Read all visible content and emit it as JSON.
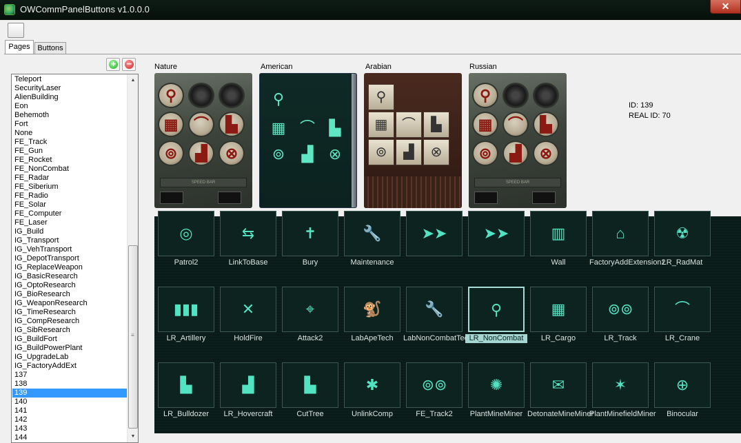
{
  "window": {
    "title": "OWCommPanelButtons v1.0.0.0",
    "close_label": "✕"
  },
  "tabs": [
    "Pages",
    "Buttons"
  ],
  "list_controls": {
    "add": "+",
    "remove": "−"
  },
  "pages_list": [
    "Teleport",
    "SecurityLaser",
    "AlienBuilding",
    "Eon",
    "Behemoth",
    "Fort",
    "None",
    "FE_Track",
    "FE_Gun",
    "FE_Rocket",
    "FE_NonCombat",
    "FE_Radar",
    "FE_Siberium",
    "FE_Radio",
    "FE_Solar",
    "FE_Computer",
    "FE_Laser",
    "IG_Build",
    "IG_Transport",
    "IG_VehTransport",
    "IG_DepotTransport",
    "IG_ReplaceWeapon",
    "IG_BasicResearch",
    "IG_OptoResearch",
    "IG_BioResearch",
    "IG_WeaponResearch",
    "IG_TimeResearch",
    "IG_CompResearch",
    "IG_SibResearch",
    "IG_BuildFort",
    "IG_BuildPowerPlant",
    "IG_UpgradeLab",
    "IG_FactoryAddExt",
    "137",
    "138",
    "139",
    "140",
    "141",
    "142",
    "143",
    "144"
  ],
  "selected_page": "139",
  "preview_labels": [
    "Nature",
    "American",
    "Arabian",
    "Russian"
  ],
  "speed_bar_text": "SPEED BAR",
  "id_info": {
    "id": "ID: 139",
    "real_id": "REAL ID: 70"
  },
  "buttons": [
    {
      "label": "Patrol2",
      "icon": "patrol-icon",
      "glyph": "◎"
    },
    {
      "label": "LinkToBase",
      "icon": "link-icon",
      "glyph": "⇆"
    },
    {
      "label": "Bury",
      "icon": "bury-icon",
      "glyph": "✝"
    },
    {
      "label": "Maintenance",
      "icon": "wrench-icon",
      "glyph": "🔧"
    },
    {
      "label": "",
      "icon": "arrows-icon",
      "glyph": "➤➤"
    },
    {
      "label": "",
      "icon": "arrows-icon",
      "glyph": "➤➤"
    },
    {
      "label": "Wall",
      "icon": "wall-icon",
      "glyph": "▥"
    },
    {
      "label": "FactoryAddExtension2",
      "icon": "factory-icon",
      "glyph": "⌂"
    },
    {
      "label": "LR_RadMat",
      "icon": "radmat-icon",
      "glyph": "☢"
    },
    {
      "label": "LR_Artillery",
      "icon": "artillery-icon",
      "glyph": "▮▮▮"
    },
    {
      "label": "HoldFire",
      "icon": "holdfire-icon",
      "glyph": "✕"
    },
    {
      "label": "Attack2",
      "icon": "crosshair-icon",
      "glyph": "⌖"
    },
    {
      "label": "LabApeTech",
      "icon": "ape-icon",
      "glyph": "🐒"
    },
    {
      "label": "LabNonCombatTech",
      "icon": "wrench-icon",
      "glyph": "🔧"
    },
    {
      "label": "LR_NonCombat",
      "icon": "shovel-icon",
      "glyph": "⚲"
    },
    {
      "label": "LR_Cargo",
      "icon": "cargo-icon",
      "glyph": "▦"
    },
    {
      "label": "LR_Track",
      "icon": "track-icon",
      "glyph": "⊚⊚"
    },
    {
      "label": "LR_Crane",
      "icon": "crane-icon",
      "glyph": "⌒"
    },
    {
      "label": "LR_Bulldozer",
      "icon": "bulldozer-icon",
      "glyph": "▙"
    },
    {
      "label": "LR_Hovercraft",
      "icon": "hovercraft-icon",
      "glyph": "▟"
    },
    {
      "label": "CutTree",
      "icon": "cuttree-icon",
      "glyph": "▙"
    },
    {
      "label": "UnlinkComp",
      "icon": "bug-icon",
      "glyph": "✱"
    },
    {
      "label": "FE_Track2",
      "icon": "track-icon",
      "glyph": "⊚⊚"
    },
    {
      "label": "PlantMineMiner",
      "icon": "mine-icon",
      "glyph": "✺"
    },
    {
      "label": "DetonateMineMiner",
      "icon": "detonate-icon",
      "glyph": "✉"
    },
    {
      "label": "PlantMinefieldMiner",
      "icon": "minefield-icon",
      "glyph": "✶"
    },
    {
      "label": "Binocular",
      "icon": "binocular-icon",
      "glyph": "⊕"
    }
  ],
  "selected_button": "LR_NonCombat"
}
